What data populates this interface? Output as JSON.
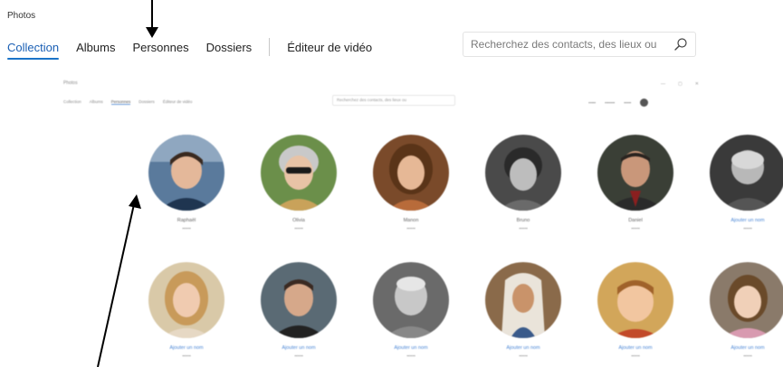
{
  "app": {
    "title": "Photos"
  },
  "tabs": [
    {
      "label": "Collection",
      "active": true
    },
    {
      "label": "Albums",
      "active": false
    },
    {
      "label": "Personnes",
      "active": false
    },
    {
      "label": "Dossiers",
      "active": false
    },
    {
      "label": "Éditeur de vidéo",
      "active": false
    }
  ],
  "search": {
    "placeholder": "Recherchez des contacts, des lieux ou"
  },
  "embedded": {
    "title": "Photos",
    "tabs": [
      "Collection",
      "Albums",
      "Personnes",
      "Dossiers",
      "Éditeur de vidéo"
    ],
    "search_placeholder": "Recherchez des contacts, des lieux ou",
    "people": [
      {
        "name": "Raphaël",
        "count": "",
        "named": true
      },
      {
        "name": "Olivia",
        "count": "",
        "named": true
      },
      {
        "name": "Manon",
        "count": "",
        "named": true
      },
      {
        "name": "Bruno",
        "count": "",
        "named": true
      },
      {
        "name": "Daniel",
        "count": "",
        "named": true
      },
      {
        "name": "Ajouter un nom",
        "count": "",
        "named": false
      },
      {
        "name": "Ajouter un nom",
        "count": "",
        "named": false
      },
      {
        "name": "Ajouter un nom",
        "count": "",
        "named": false
      },
      {
        "name": "Ajouter un nom",
        "count": "",
        "named": false
      },
      {
        "name": "Ajouter un nom",
        "count": "",
        "named": false
      },
      {
        "name": "Ajouter un nom",
        "count": "",
        "named": false
      },
      {
        "name": "Ajouter un nom",
        "count": "",
        "named": false
      }
    ]
  },
  "colors": {
    "accent": "#1a73c8",
    "link": "#4a86d6",
    "text": "#222222",
    "muted": "#8a8a8a"
  },
  "icons": {
    "search": "search-icon",
    "arrow": "annotation-arrow"
  }
}
